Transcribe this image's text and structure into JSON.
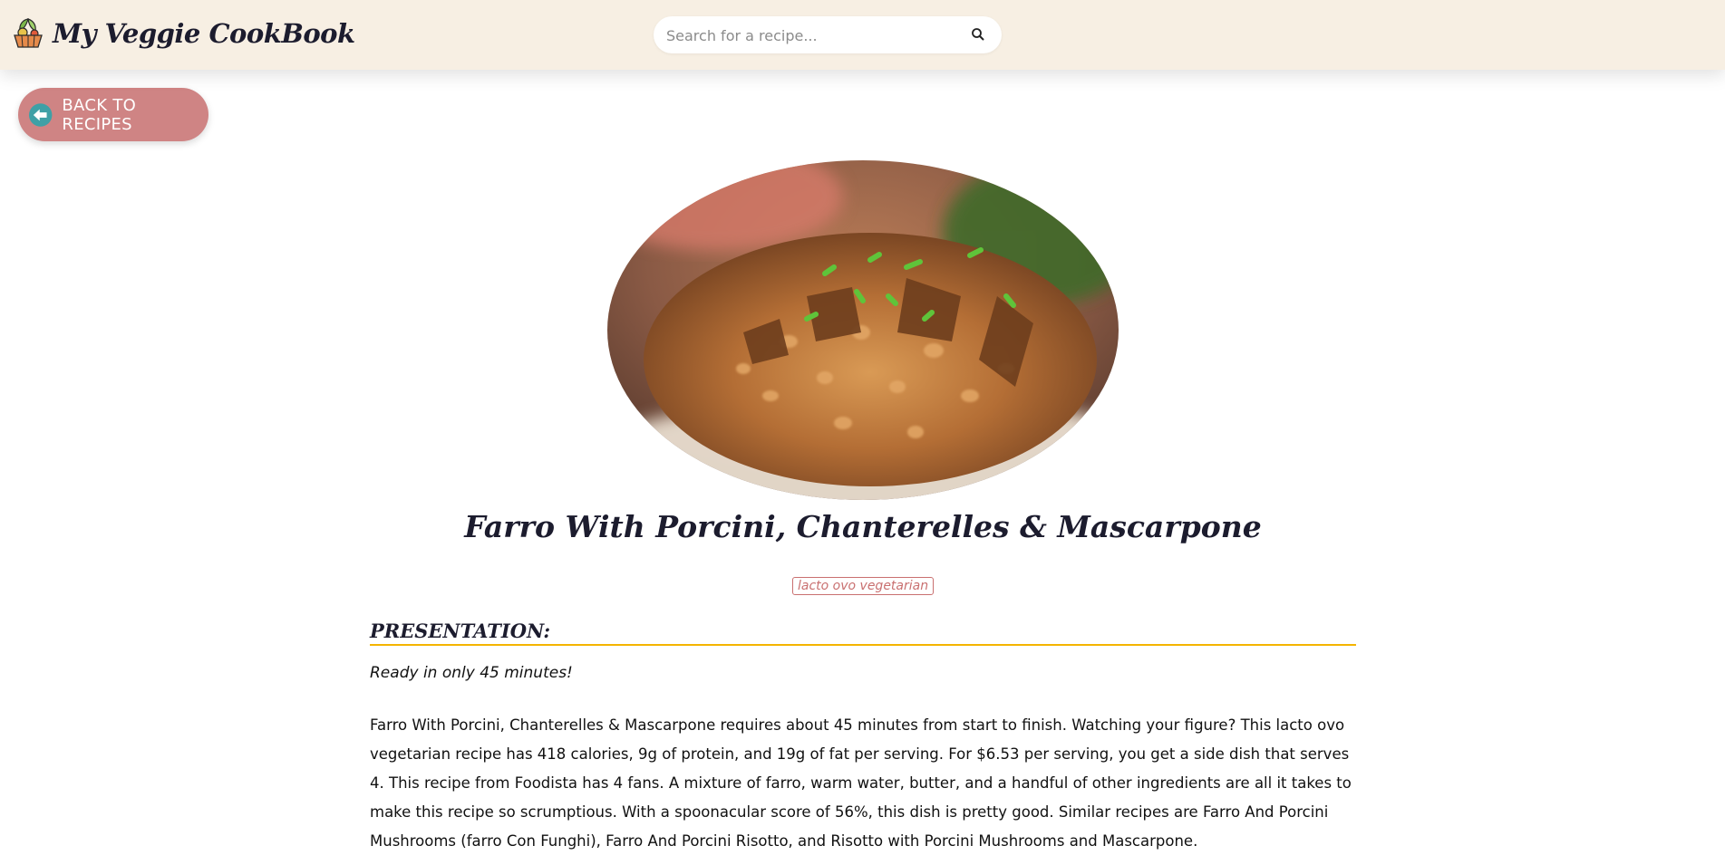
{
  "header": {
    "brand": "My Veggie CookBook",
    "logo_icon": "vegetable-basket-icon",
    "search": {
      "placeholder": "Search for a recipe...",
      "value": "",
      "icon": "search-icon"
    }
  },
  "nav": {
    "back_label": "BACK TO RECIPES",
    "back_icon": "arrow-left-circle-icon"
  },
  "recipe": {
    "image_alt": "Farro risotto with porcini and chanterelle mushrooms topped with chives",
    "title": "Farro With Porcini, Chanterelles & Mascarpone",
    "tag": "lacto ovo vegetarian",
    "section_title": "PRESENTATION:",
    "ready_text": "Ready in only 45 minutes!",
    "description": "Farro With Porcini, Chanterelles & Mascarpone requires about 45 minutes from start to finish. Watching your figure? This lacto ovo vegetarian recipe has 418 calories, 9g of protein, and 19g of fat per serving. For $6.53 per serving, you get a side dish that serves 4. This recipe from Foodista has 4 fans. A mixture of farro, warm water, butter, and a handful of other ingredients are all it takes to make this recipe so scrumptious. With a spoonacular score of 56%, this dish is pretty good. Similar recipes are Farro And Porcini Mushrooms (farro Con Funghi), Farro And Porcini Risotto, and Risotto with Porcini Mushrooms and Mascarpone."
  },
  "colors": {
    "header_bg": "#f7efe3",
    "back_button": "#cf8484",
    "back_icon": "#3fa0a6",
    "tag": "#c97070",
    "section_underline": "#f4b400",
    "heading_text": "#1c1c2e"
  }
}
